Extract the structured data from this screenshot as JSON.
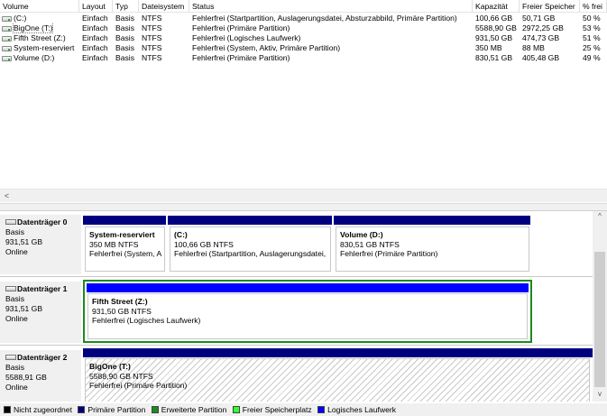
{
  "volume_list": {
    "columns": [
      "Volume",
      "Layout",
      "Typ",
      "Dateisystem",
      "Status",
      "Kapazität",
      "Freier Speicher",
      "% frei"
    ],
    "rows": [
      {
        "volume": "(C:)",
        "layout": "Einfach",
        "typ": "Basis",
        "fs": "NTFS",
        "status": "Fehlerfrei (Startpartition, Auslagerungsdatei, Absturzabbild, Primäre Partition)",
        "capacity": "100,66 GB",
        "free": "50,71 GB",
        "pct": "50 %"
      },
      {
        "volume": "BigOne (T:)",
        "layout": "Einfach",
        "typ": "Basis",
        "fs": "NTFS",
        "status": "Fehlerfrei (Primäre Partition)",
        "capacity": "5588,90 GB",
        "free": "2972,25 GB",
        "pct": "53 %"
      },
      {
        "volume": "Fifth Street (Z:)",
        "layout": "Einfach",
        "typ": "Basis",
        "fs": "NTFS",
        "status": "Fehlerfrei (Logisches Laufwerk)",
        "capacity": "931,50 GB",
        "free": "474,73 GB",
        "pct": "51 %"
      },
      {
        "volume": "System-reserviert",
        "layout": "Einfach",
        "typ": "Basis",
        "fs": "NTFS",
        "status": "Fehlerfrei (System, Aktiv, Primäre Partition)",
        "capacity": "350 MB",
        "free": "88 MB",
        "pct": "25 %"
      },
      {
        "volume": "Volume (D:)",
        "layout": "Einfach",
        "typ": "Basis",
        "fs": "NTFS",
        "status": "Fehlerfrei (Primäre Partition)",
        "capacity": "830,51 GB",
        "free": "405,48 GB",
        "pct": "49 %"
      }
    ],
    "scroll_left_glyph": "<"
  },
  "disks": [
    {
      "name": "Datenträger 0",
      "type": "Basis",
      "size": "931,51 GB",
      "status": "Online",
      "partitions": [
        {
          "name": "System-reserviert",
          "size": "350 MB NTFS",
          "status": "Fehlerfrei (System, A"
        },
        {
          "name": "(C:)",
          "size": "100,66 GB NTFS",
          "status": "Fehlerfrei (Startpartition, Auslagerungsdatei,"
        },
        {
          "name": "Volume  (D:)",
          "size": "830,51 GB NTFS",
          "status": "Fehlerfrei (Primäre Partition)"
        }
      ]
    },
    {
      "name": "Datenträger 1",
      "type": "Basis",
      "size": "931,51 GB",
      "status": "Online",
      "partitions": [
        {
          "name": "Fifth Street  (Z:)",
          "size": "931,50 GB NTFS",
          "status": "Fehlerfrei (Logisches Laufwerk)"
        }
      ]
    },
    {
      "name": "Datenträger 2",
      "type": "Basis",
      "size": "5588,91 GB",
      "status": "Online",
      "partitions": [
        {
          "name": "BigOne  (T:)",
          "size": "5588,90 GB NTFS",
          "status": "Fehlerfrei (Primäre Partition)"
        }
      ]
    }
  ],
  "legend": [
    {
      "label": "Nicht zugeordnet",
      "color": "#000000"
    },
    {
      "label": "Primäre Partition",
      "color": "#00007f"
    },
    {
      "label": "Erweiterte Partition",
      "color": "#1e8a1e"
    },
    {
      "label": "Freier Speicherplatz",
      "color": "#33ff33"
    },
    {
      "label": "Logisches Laufwerk",
      "color": "#0000ff"
    }
  ],
  "scrollbar": {
    "up_glyph": "^",
    "down_glyph": "v"
  }
}
